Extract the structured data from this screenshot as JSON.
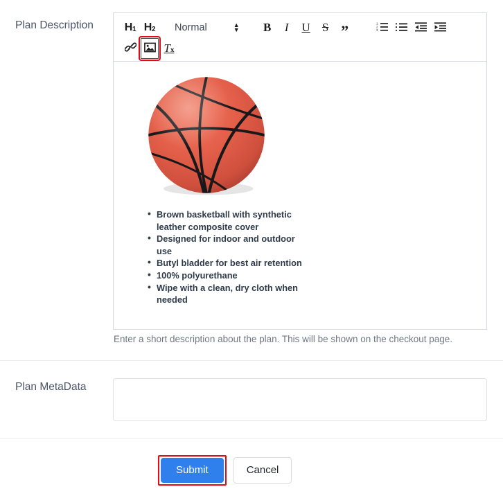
{
  "form": {
    "description_row": {
      "label": "Plan Description",
      "help_text": "Enter a short description about the plan. This will be shown on the checkout page."
    },
    "metadata_row": {
      "label": "Plan MetaData",
      "value": "",
      "placeholder": ""
    }
  },
  "editor": {
    "toolbar": {
      "h1_label": "H",
      "h1_sub": "1",
      "h2_label": "H",
      "h2_sub": "2",
      "format_select": {
        "selected": "Normal"
      },
      "bold_label": "B",
      "italic_label": "I",
      "underline_label": "U",
      "strike_label": "S",
      "blockquote_label": "”",
      "clear_format_label": "T",
      "clear_format_sub": "x",
      "ordered_list_name": "ordered-list",
      "unordered_list_name": "unordered-list",
      "outdent_name": "outdent",
      "indent_name": "indent",
      "link_name": "link",
      "image_name": "image"
    },
    "content": {
      "image_alt": "basketball",
      "bullets": [
        "Brown basketball with synthetic leather composite cover",
        "Designed for indoor and outdoor use",
        "Butyl bladder for best air retention",
        "100% polyurethane",
        "Wipe with a clean, dry cloth when needed"
      ]
    }
  },
  "actions": {
    "submit_label": "Submit",
    "cancel_label": "Cancel"
  },
  "colors": {
    "submit_bg": "#2f80ed",
    "highlight": "#e50914",
    "label_text": "#4a5568",
    "help_text": "#6f7782",
    "bullet_text": "#2f3b4a",
    "basketball": "#e05a45"
  }
}
